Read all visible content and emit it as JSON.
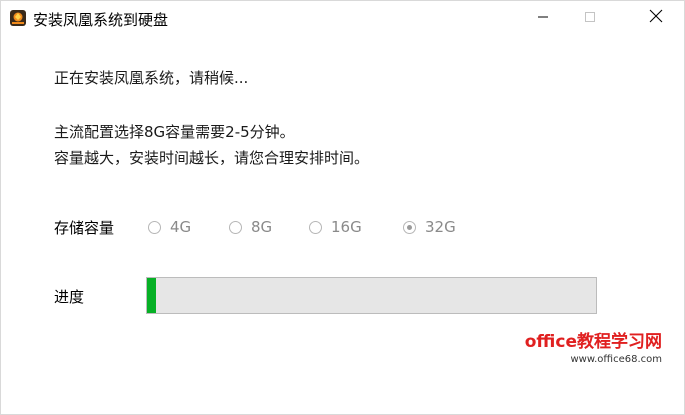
{
  "window": {
    "title": "安装凤凰系统到硬盘",
    "icon": "app-icon",
    "controls": [
      "minimize-icon",
      "maximize-icon",
      "close-icon"
    ]
  },
  "status": {
    "text": "正在安装凤凰系统，请稍候..."
  },
  "info": {
    "line1": "主流配置选择8G容量需要2-5分钟。",
    "line2": "容量越大，安装时间越长，请您合理安排时间。"
  },
  "storage": {
    "label": "存储容量",
    "options": [
      "4G",
      "8G",
      "16G",
      "32G"
    ],
    "selected": "32G"
  },
  "progress": {
    "label": "进度",
    "fraction": 0.02,
    "fill_color": "#06b025"
  },
  "watermark": {
    "main": "office教程学习网",
    "sub": "www.office68.com"
  }
}
